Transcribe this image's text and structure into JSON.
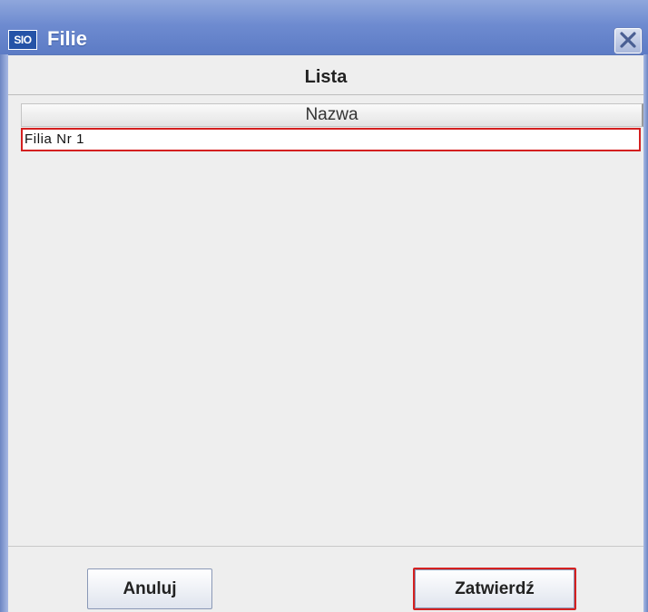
{
  "window": {
    "title": "Filie",
    "app_icon_text": "SIO",
    "close_icon": "close-icon"
  },
  "panel": {
    "title": "Lista"
  },
  "table": {
    "columns": [
      "Nazwa"
    ],
    "rows": [
      {
        "nazwa": "Filia Nr 1",
        "selected": true
      }
    ]
  },
  "buttons": {
    "cancel_label": "Anuluj",
    "confirm_label": "Zatwierdź"
  },
  "colors": {
    "titlebar": "#6e8bd0",
    "highlight": "#d42020",
    "background": "#eeeeee"
  }
}
